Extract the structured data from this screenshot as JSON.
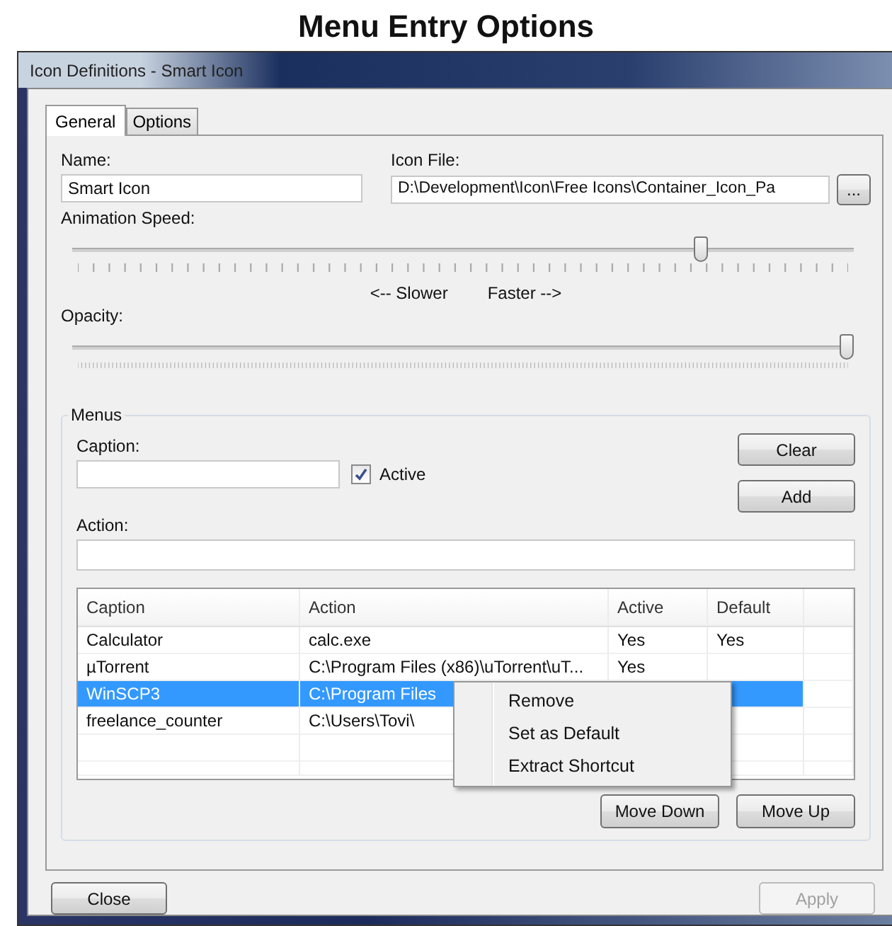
{
  "heading": "Menu Entry Options",
  "window": {
    "title": "Icon Definitions - Smart Icon"
  },
  "tabs": [
    {
      "label": "General",
      "selected": true
    },
    {
      "label": "Options",
      "selected": false
    }
  ],
  "name_field": {
    "label": "Name:",
    "value": "Smart Icon"
  },
  "icon_file_field": {
    "label": "Icon File:",
    "value": "D:\\Development\\Icon\\Free Icons\\Container_Icon_Pa",
    "browse_button": "..."
  },
  "animation_speed": {
    "label": "Animation Speed:",
    "level": 0.81,
    "slower_label": "<-- Slower",
    "faster_label": "Faster -->"
  },
  "opacity": {
    "label": "Opacity:",
    "level": 1
  },
  "menus": {
    "title": "Menus",
    "caption_label": "Caption:",
    "active_checkbox": {
      "label": "Active",
      "checked": true
    },
    "action_label": "Action:",
    "buttons": [
      "Clear",
      "Add"
    ],
    "table": {
      "columns": [
        "Caption",
        "Action",
        "Active",
        "Default"
      ],
      "rows": [
        {
          "caption": "Calculator",
          "action": "calc.exe",
          "active": "Yes",
          "default": "Yes",
          "selected": false
        },
        {
          "caption": "µTorrent",
          "action": "C:\\Program Files (x86)\\uTorrent\\uT...",
          "active": "Yes",
          "selected": false
        },
        {
          "caption": "WinSCP3",
          "action": "C:\\Program Files",
          "selected": true
        },
        {
          "caption": "freelance_counter",
          "action": "C:\\Users\\Tovi\\",
          "selected": false
        }
      ]
    },
    "context_menu": [
      "Remove",
      "Set as Default",
      "Extract Shortcut"
    ],
    "move_buttons": [
      "Move Down",
      "Move Up"
    ]
  },
  "footer_buttons": [
    {
      "label": "Close",
      "disabled": false
    },
    {
      "label": "Apply",
      "disabled": true
    }
  ]
}
